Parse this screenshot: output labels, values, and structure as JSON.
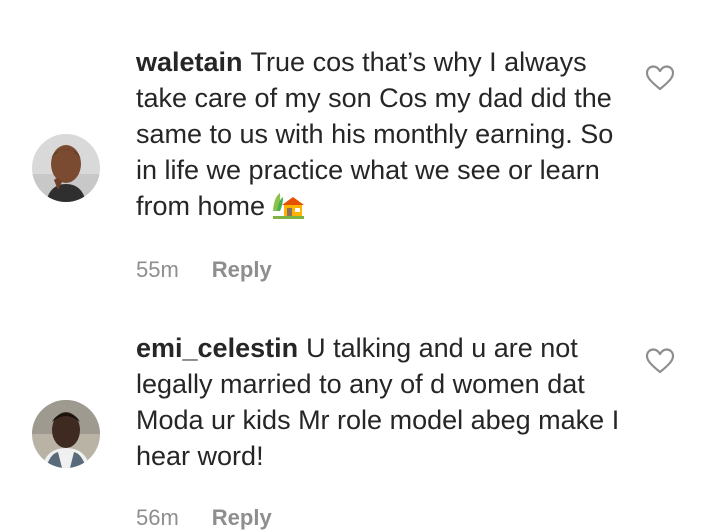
{
  "comments": [
    {
      "username": "waletain",
      "text": "True cos that’s why I always take care of my son Cos my dad did the same to us with his monthly earning. So in life we practice what we see or learn from home",
      "emoji": "house-with-garden",
      "time": "55m",
      "reply_label": "Reply",
      "icons": {
        "like": "heart-outline-icon",
        "avatar": "profile-photo"
      }
    },
    {
      "username": "emi_celestin",
      "text": "U talking and u are not legally married to any of d women dat Moda ur kids Mr role model abeg make I hear word!",
      "time": "56m",
      "reply_label": "Reply",
      "icons": {
        "like": "heart-outline-icon",
        "avatar": "profile-photo"
      }
    }
  ],
  "colors": {
    "text": "#262626",
    "meta": "#8e8e8e",
    "background": "#ffffff"
  }
}
